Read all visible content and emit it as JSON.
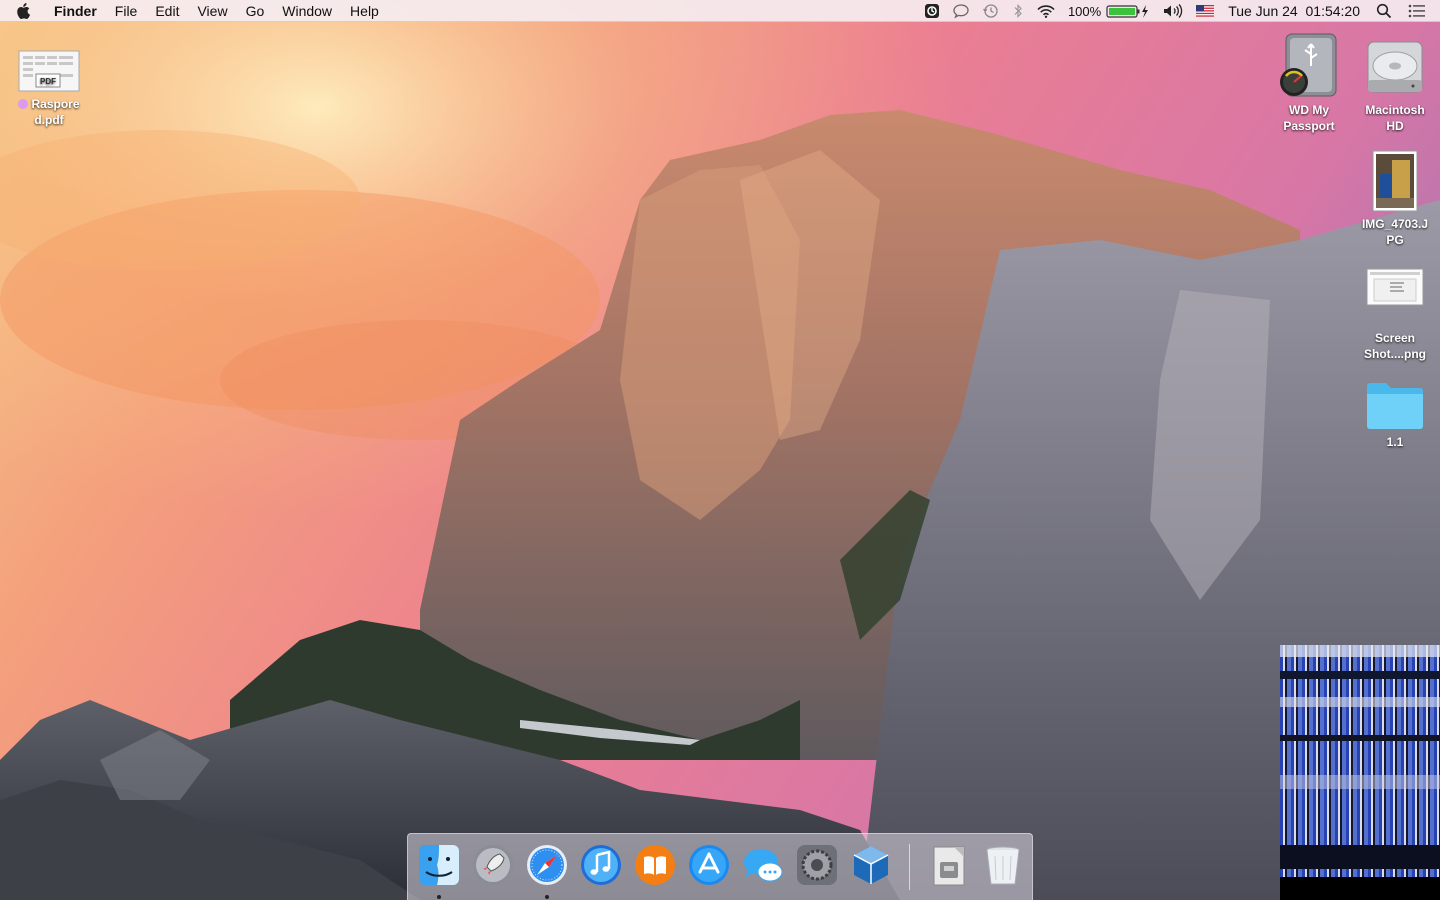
{
  "menubar": {
    "app_name": "Finder",
    "menus": [
      "File",
      "Edit",
      "View",
      "Go",
      "Window",
      "Help"
    ],
    "battery_percent": "100%",
    "clock": "Tue Jun 24  01:54:20"
  },
  "desktop": {
    "left_items": [
      {
        "label": "Raspored.pdf",
        "label_line1": "Raspore",
        "label_line2": "d.pdf",
        "icon": "pdf-file-icon",
        "tag_color": "#d99af0"
      }
    ],
    "right_items": [
      {
        "label_line1": "WD My",
        "label_line2": "Passport",
        "icon": "external-drive-icon"
      },
      {
        "label_line1": "Macintosh",
        "label_line2": "HD",
        "icon": "hard-drive-icon"
      },
      {
        "label_line1": "IMG_4703.J",
        "label_line2": "PG",
        "icon": "image-file-icon"
      },
      {
        "label_line1": "Screen",
        "label_line2": "Shot....png",
        "icon": "screenshot-file-icon"
      },
      {
        "label_line1": "1.1",
        "label_line2": "",
        "icon": "folder-icon"
      }
    ]
  },
  "dock": {
    "apps": [
      {
        "name": "Finder",
        "icon": "finder-icon",
        "running": true
      },
      {
        "name": "Launchpad",
        "icon": "launchpad-icon",
        "running": false
      },
      {
        "name": "Safari",
        "icon": "safari-icon",
        "running": true
      },
      {
        "name": "iTunes",
        "icon": "itunes-icon",
        "running": false
      },
      {
        "name": "iBooks",
        "icon": "ibooks-icon",
        "running": false
      },
      {
        "name": "App Store",
        "icon": "app-store-icon",
        "running": false
      },
      {
        "name": "Messages",
        "icon": "messages-icon",
        "running": false
      },
      {
        "name": "System Preferences",
        "icon": "system-preferences-icon",
        "running": false
      },
      {
        "name": "VirtualBox",
        "icon": "virtualbox-icon",
        "running": false
      },
      {
        "name": "Documents",
        "icon": "documents-stack-icon",
        "running": false
      },
      {
        "name": "Trash",
        "icon": "trash-icon",
        "running": false
      }
    ]
  },
  "colors": {
    "sky_top": "#f0789a",
    "sky_warm": "#f6b27a",
    "rock": "#8a7f7d",
    "folder_blue": "#5ec8f4",
    "battery_green": "#3cc23c"
  }
}
